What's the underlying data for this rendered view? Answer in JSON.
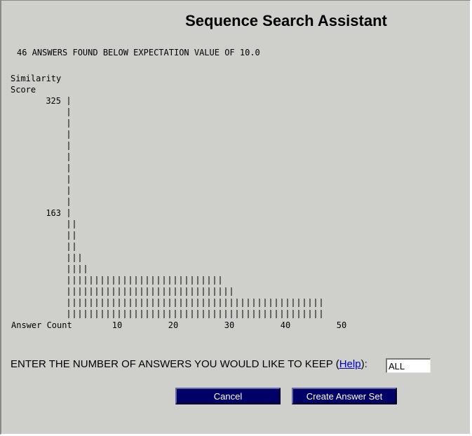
{
  "page": {
    "title": "Sequence Search Assistant"
  },
  "summary": {
    "text": "46 ANSWERS FOUND BELOW EXPECTATION VALUE OF 10.0"
  },
  "chart_data": {
    "type": "bar",
    "ylabel": "Similarity\nScore",
    "xlabel": "Answer Count",
    "y_ticks": [
      "325",
      "163"
    ],
    "x_ticks": [
      "10",
      "20",
      "30",
      "40",
      "50"
    ],
    "xlim": [
      0,
      50
    ],
    "rows": [
      {
        "count": 1
      },
      {
        "count": 1
      },
      {
        "count": 1
      },
      {
        "count": 1
      },
      {
        "count": 1
      },
      {
        "count": 1
      },
      {
        "count": 1
      },
      {
        "count": 1
      },
      {
        "count": 1
      },
      {
        "count": 1
      },
      {
        "count": 1
      },
      {
        "count": 2
      },
      {
        "count": 2
      },
      {
        "count": 2
      },
      {
        "count": 3
      },
      {
        "count": 4
      },
      {
        "count": 28
      },
      {
        "count": 30
      },
      {
        "count": 46
      },
      {
        "count": 46
      }
    ],
    "tick_rows": {
      "325": 0,
      "163": 10
    }
  },
  "form": {
    "keep_label": "ENTER THE NUMBER OF ANSWERS YOU WOULD LIKE TO KEEP (",
    "help_text": "Help",
    "keep_suffix": "):",
    "keep_value": "ALL"
  },
  "buttons": {
    "cancel": "Cancel",
    "create": "Create Answer Set"
  }
}
